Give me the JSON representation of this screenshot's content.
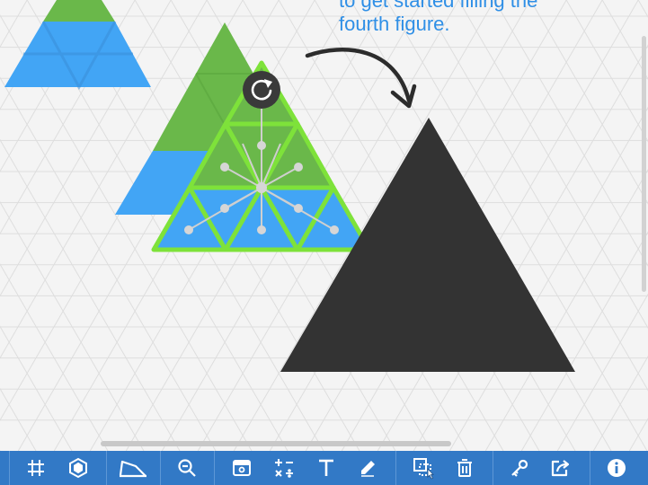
{
  "instruction": {
    "line1": "to get started filling the",
    "line2": "fourth figure."
  },
  "colors": {
    "canvas_bg": "#f4f4f4",
    "grid_line": "#dedede",
    "blue_fill": "#42a5f5",
    "green_fill": "#6ab84a",
    "selection_outline": "#7ee23a",
    "target_fill": "#333333",
    "rotate_handle": "#3a3a3a",
    "toolbar_bg": "#3279c6",
    "instruction_text": "#2f8fe6"
  },
  "toolbar": {
    "buttons": [
      "grid-icon",
      "hexagon-settings-icon",
      "line-tool-icon",
      "zoom-out-icon",
      "background-icon",
      "math-symbols-icon",
      "text-tool-icon",
      "pencil-icon",
      "select-copy-icon",
      "trash-icon",
      "key-icon",
      "share-icon",
      "info-icon"
    ]
  }
}
